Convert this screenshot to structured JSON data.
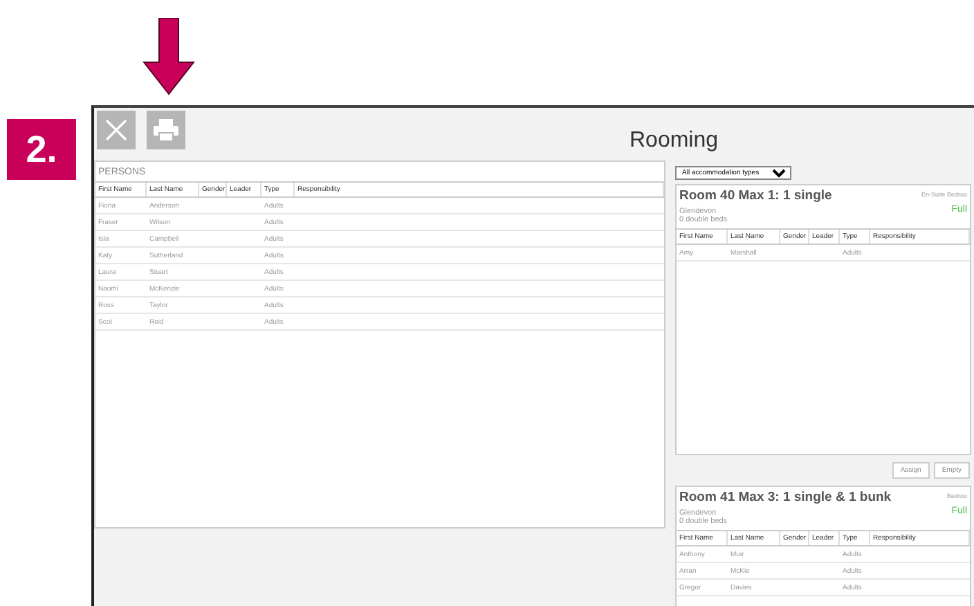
{
  "step_badge": "2.",
  "window": {
    "title": "Rooming"
  },
  "toolbar": [
    {
      "kind": "close"
    },
    {
      "kind": "print"
    }
  ],
  "persons": {
    "title": "PERSONS",
    "columns": [
      "First Name",
      "Last Name",
      "Gender",
      "Leader",
      "Type",
      "Responsibility"
    ],
    "rows": [
      [
        "Fiona",
        "Anderson",
        "",
        "",
        "Adults",
        ""
      ],
      [
        "Fraser",
        "Wilson",
        "",
        "",
        "Adults",
        ""
      ],
      [
        "Isla",
        "Campbell",
        "",
        "",
        "Adults",
        ""
      ],
      [
        "Katy",
        "Sutherland",
        "",
        "",
        "Adults",
        ""
      ],
      [
        "Laura",
        "Stuart",
        "",
        "",
        "Adults",
        ""
      ],
      [
        "Naomi",
        "McKenzie",
        "",
        "",
        "Adults",
        ""
      ],
      [
        "Ross",
        "Taylor",
        "",
        "",
        "Adults",
        ""
      ],
      [
        "Scot",
        "Reid",
        "",
        "",
        "Adults",
        ""
      ]
    ]
  },
  "filter": {
    "value": "All accommodation types"
  },
  "rooms": [
    {
      "title": "Room 40 Max 1: 1 single",
      "location": "Glendevon",
      "beds": "0 double beds",
      "room_type": "En-Suite Bedroo",
      "status": "Full",
      "columns": [
        "First Name",
        "Last Name",
        "Gender",
        "Leader",
        "Type",
        "Responsibility"
      ],
      "rows": [
        [
          "Amy",
          "Marshall",
          "",
          "",
          "Adults",
          ""
        ]
      ],
      "buttons": [
        "Assign",
        "Empty"
      ]
    },
    {
      "title": "Room 41 Max 3: 1 single & 1 bunk",
      "location": "Glendevon",
      "beds": "0 double beds",
      "room_type": "Bedroo",
      "status": "Full",
      "columns": [
        "First Name",
        "Last Name",
        "Gender",
        "Leader",
        "Type",
        "Responsibility"
      ],
      "rows": [
        [
          "Anthony",
          "Muir",
          "",
          "",
          "Adults",
          ""
        ],
        [
          "Arran",
          "McKie",
          "",
          "",
          "Adults",
          ""
        ],
        [
          "Gregor",
          "Davies",
          "",
          "",
          "Adults",
          ""
        ]
      ]
    }
  ]
}
